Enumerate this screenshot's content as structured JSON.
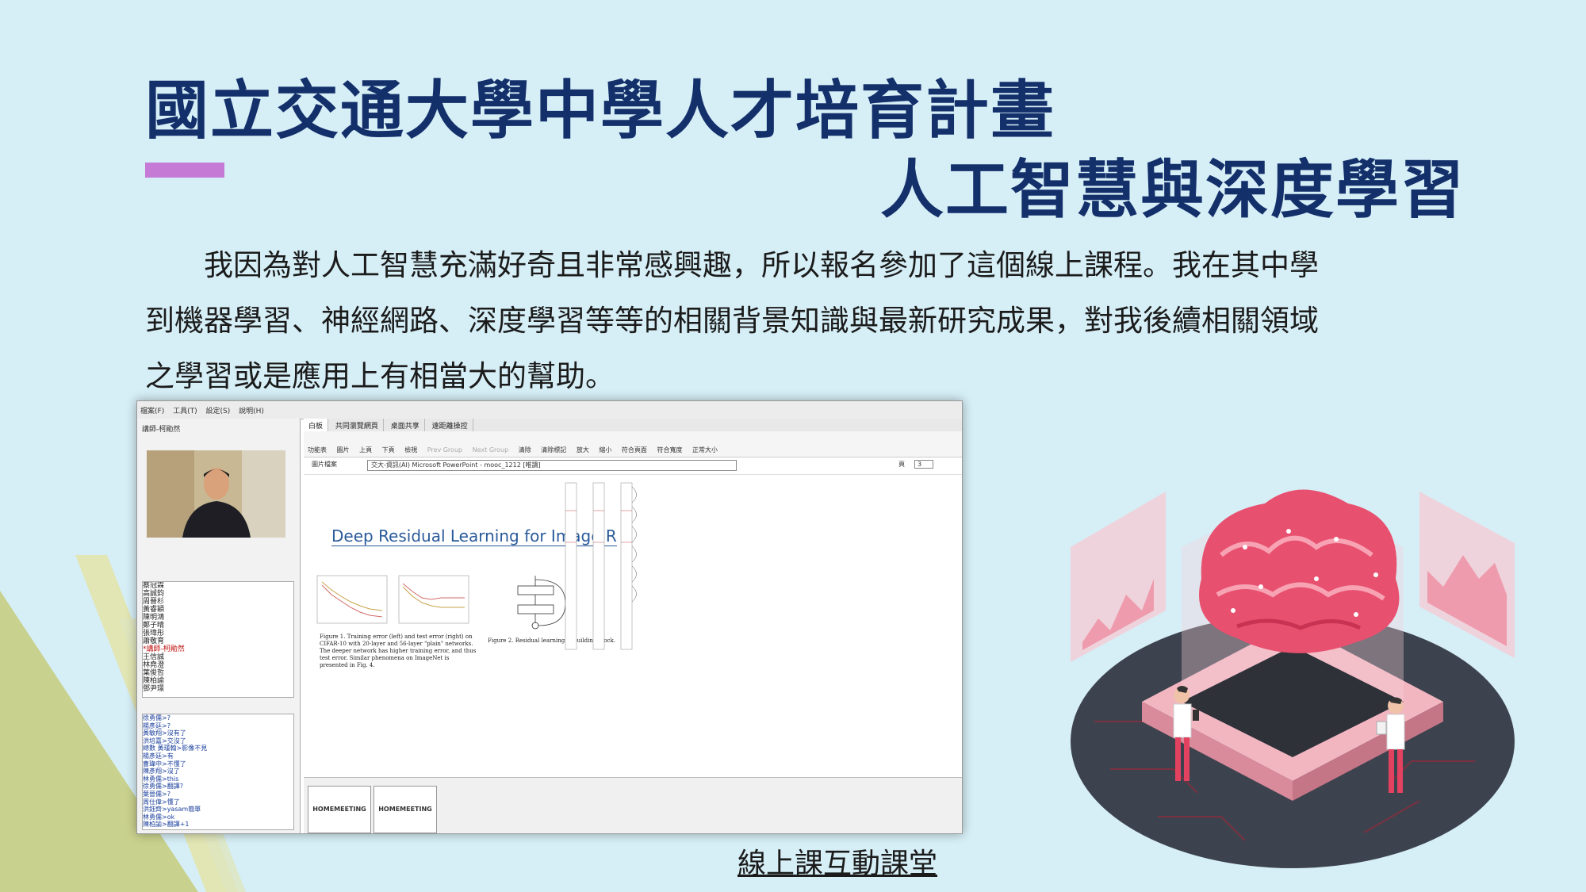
{
  "slide": {
    "title_line1": "國立交通大學中學人才培育計畫",
    "title_line2": "人工智慧與深度學習",
    "paragraph_lines": [
      "　　我因為對人工智慧充滿好奇且非常感興趣，所以報名參加了這個線上課程。我在其中學",
      "到機器學習、神經網路、深度學習等等的相關背景知識與最新研究成果，對我後續相關領域",
      "之學習或是應用上有相當大的幫助。"
    ],
    "caption": "線上課互動課堂"
  },
  "screenshot": {
    "menu": [
      "檔案(F)",
      "工具(T)",
      "設定(S)",
      "說明(H)"
    ],
    "teacher_label": "講師-柯勛然",
    "tabs": [
      "白板",
      "共同瀏覽網頁",
      "桌面共享",
      "遠距離操控"
    ],
    "toolbar": [
      "功能表",
      "圖片",
      "上頁",
      "下頁",
      "檢視",
      "Prev Group",
      "Next Group",
      "清除",
      "清除標記",
      "放大",
      "縮小",
      "符合頁面",
      "符合寬度",
      "正常大小"
    ],
    "file_label": "圖片檔案",
    "file_value": "交大-資訊(AI) Microsoft PowerPoint - mooc_1212 [唯讀]",
    "page_label": "頁",
    "page_value": "3",
    "roster": [
      "蔡冠霖",
      "高誠鈞",
      "周晉杉",
      "黃睿穎",
      "陳明鴻",
      "鄭子晴",
      "張瑋彤",
      "蕭敬育",
      "*講師-柯勛然",
      "王信誠",
      "林堯澄",
      "葉俊哲",
      "陳柏諭",
      "鄧尹璟"
    ],
    "chat": [
      "徐勇儒>?",
      "楊彥廷>?",
      "黃敏翔>沒有了",
      "洪培嘉>交沒了",
      "總數 黃瑾翰>影像不見",
      "楊彥廷>有",
      "曹瑋中>不懂了",
      "陳彥翔>沒了",
      "林勇儒>this",
      "徐勇儒>翻譯?",
      "葉晉儒>?",
      "周仕偉>懂了",
      "洪鈺齊>yasam簡單",
      "林勇儒>ok",
      "陳柏諭>翻譯+1"
    ],
    "slide_title": "Deep Residual Learning for Image R",
    "fig1_caption": "Figure 1. Training error (left) and test error (right) on CIFAR-10 with 20-layer and 56-layer \"plain\" networks. The deeper network has higher training error, and thus test error. Similar phenomena on ImageNet is presented in Fig. 4.",
    "fig2_caption": "Figure 2. Residual learning: a building block.",
    "thumb_label": "HOMEMEETING"
  },
  "colors": {
    "background": "#d6eef6",
    "title": "#14306b",
    "accent_bar": "#c57ad6",
    "brain": "#e8506f"
  }
}
